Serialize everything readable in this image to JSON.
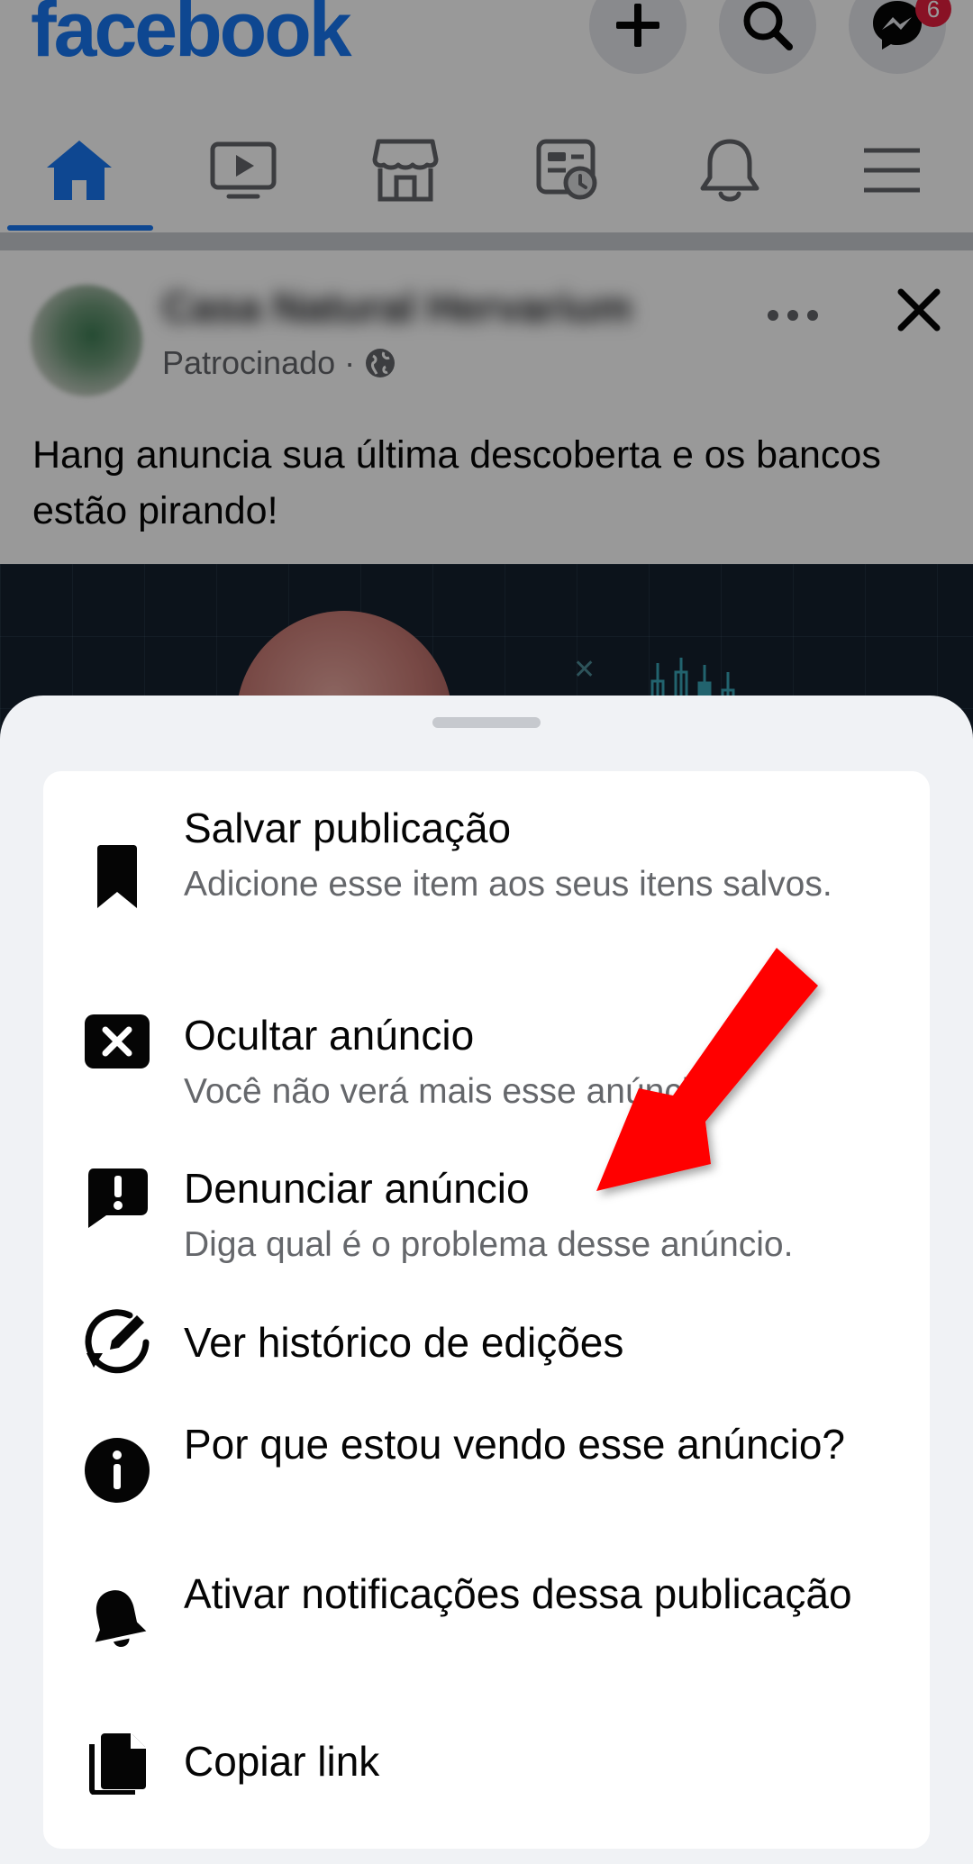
{
  "header": {
    "logo": "facebook",
    "messenger_badge": "6",
    "icons": [
      "add-icon",
      "search-icon",
      "messenger-icon"
    ]
  },
  "nav": {
    "tabs": [
      "home-icon",
      "video-icon",
      "marketplace-icon",
      "feeds-icon",
      "notifications-icon",
      "menu-icon"
    ],
    "active_tab": "home-icon",
    "accent_color": "#1877f2"
  },
  "post": {
    "page_name": "Casa Natural Hervarium",
    "sponsored_label": "Patrocinado",
    "separator": "·",
    "caption": "Hang anuncia sua última descoberta e os bancos estão pirando!"
  },
  "menu": {
    "items": [
      {
        "icon": "bookmark-icon",
        "title": "Salvar publicação",
        "subtitle": "Adicione esse item aos seus itens salvos."
      },
      {
        "icon": "close-box-icon",
        "title": "Ocultar anúncio",
        "subtitle": "Você não verá mais esse anúncio."
      },
      {
        "icon": "report-icon",
        "title": "Denunciar anúncio",
        "subtitle": "Diga qual é o problema desse anúncio."
      },
      {
        "icon": "edit-history-icon",
        "title": "Ver histórico de edições"
      },
      {
        "icon": "info-icon",
        "title": "Por que estou vendo esse anúncio?"
      },
      {
        "icon": "bell-icon",
        "title": "Ativar notificações dessa publicação"
      },
      {
        "icon": "copy-icon",
        "title": "Copiar link"
      }
    ]
  },
  "annotation": {
    "icon": "red-arrow-icon",
    "color": "#ff0000",
    "points_to": "Denunciar anúncio"
  }
}
